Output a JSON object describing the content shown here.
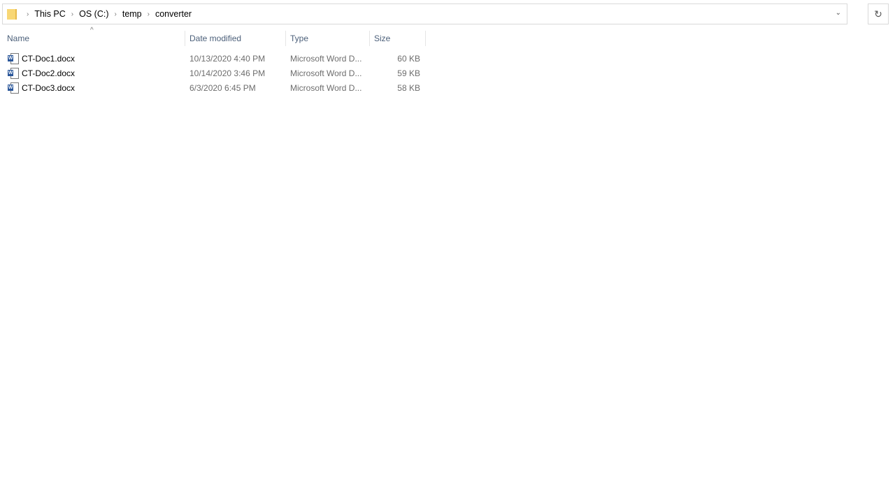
{
  "breadcrumb": [
    "This PC",
    "OS (C:)",
    "temp",
    "converter"
  ],
  "columns": {
    "name": "Name",
    "date": "Date modified",
    "type": "Type",
    "size": "Size"
  },
  "files": [
    {
      "name": "CT-Doc1.docx",
      "date": "10/13/2020 4:40 PM",
      "type": "Microsoft Word D...",
      "size": "60 KB"
    },
    {
      "name": "CT-Doc2.docx",
      "date": "10/14/2020 3:46 PM",
      "type": "Microsoft Word D...",
      "size": "59 KB"
    },
    {
      "name": "CT-Doc3.docx",
      "date": "6/3/2020 6:45 PM",
      "type": "Microsoft Word D...",
      "size": "58 KB"
    }
  ],
  "icons": {
    "folder": "folder-icon",
    "refresh": "refresh-icon",
    "dropdown": "chevron-down-icon",
    "file": "word-doc-icon"
  }
}
